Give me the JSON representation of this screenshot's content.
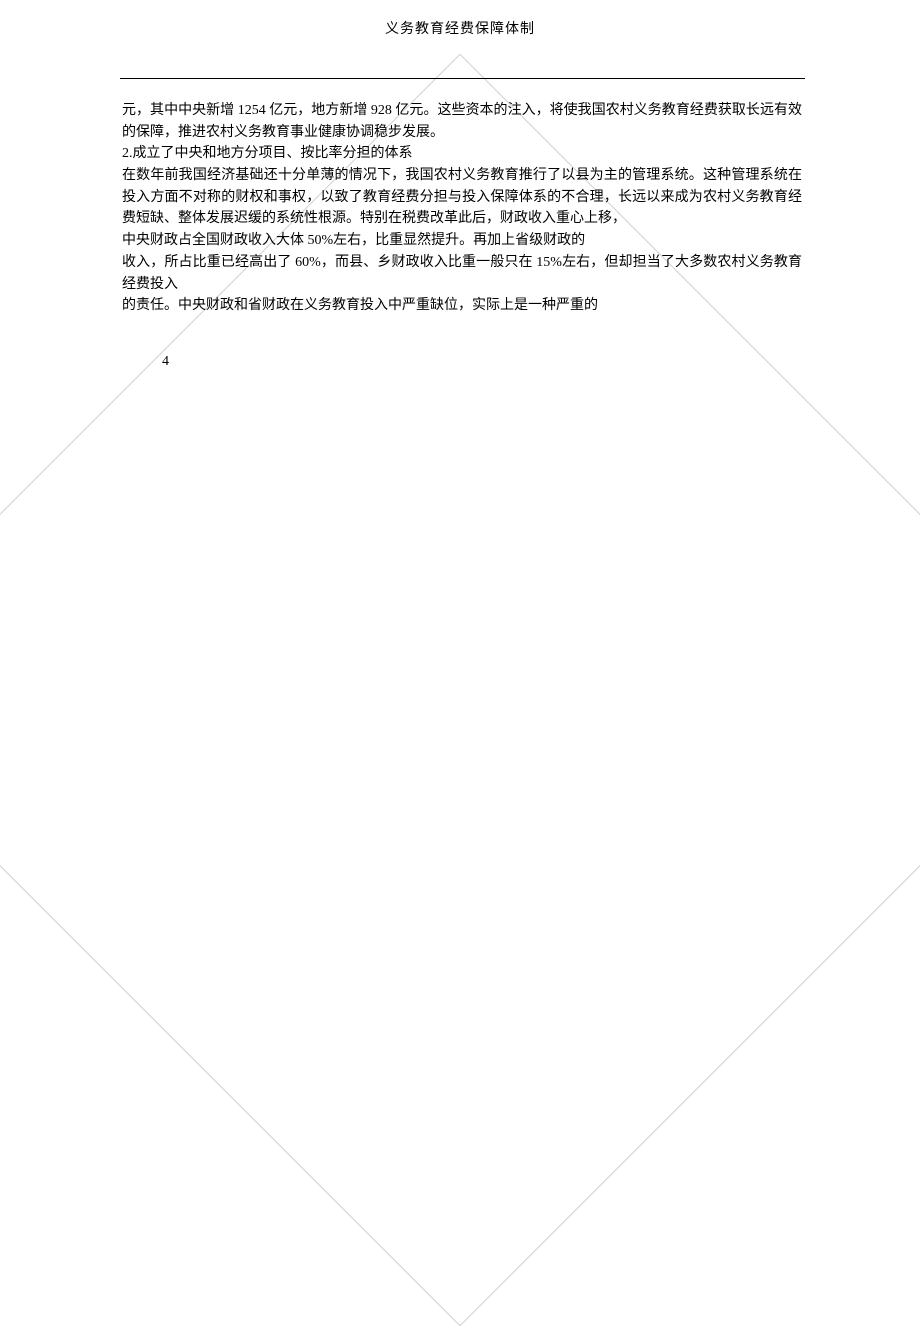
{
  "header": {
    "title": "义务教育经费保障体制"
  },
  "content": {
    "p1": "元，其中中央新增 1254 亿元，地方新增 928 亿元。这些资本的注入，将使我国农村义务教育经费获取长远有效的保障，推进农村义务教育事业健康协调稳步发展。",
    "p2": "2.成立了中央和地方分项目、按比率分担的体系",
    "p3": "在数年前我国经济基础还十分单薄的情况下，我国农村义务教育推行了以县为主的管理系统。这种管理系统在投入方面不对称的财权和事权，以致了教育经费分担与投入保障体系的不合理，长远以来成为农村义务教育经费短缺、整体发展迟缓的系统性根源。特别在税费改革此后，财政收入重心上移，",
    "p4": "中央财政占全国财政收入大体 50%左右，比重显然提升。再加上省级财政的",
    "p5": "收入，所占比重已经高出了 60%，而县、乡财政收入比重一般只在 15%左右，但却担当了大多数农村义务教育经费投入",
    "p6": "的责任。中央财政和省财政在义务教育投入中严重缺位，实际上是一种严重的"
  },
  "pageNumber": "4"
}
